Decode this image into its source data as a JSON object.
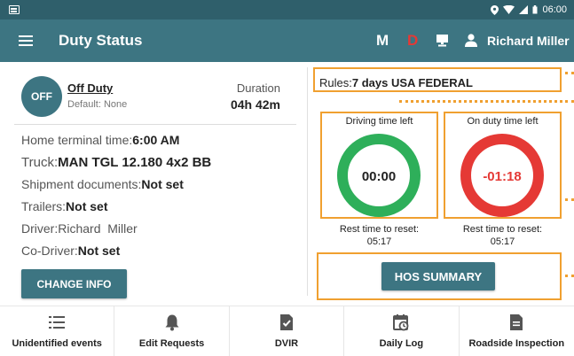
{
  "status_bar": {
    "time": "06:00"
  },
  "app_bar": {
    "title": "Duty Status",
    "badge_m": "M",
    "badge_d": "D",
    "user_name": "Richard Miller"
  },
  "duty": {
    "status_short": "OFF",
    "status_name": "Off Duty",
    "default": "Default: None",
    "duration_label": "Duration",
    "duration_value": "04h 42m"
  },
  "info": {
    "home_terminal_label": "Home terminal time:",
    "home_terminal_value": "6:00 AM",
    "truck_label": "Truck:",
    "truck_value": "MAN TGL 12.180 4x2 BB",
    "shipment_label": "Shipment documents:",
    "shipment_value": "Not set",
    "trailers_label": "Trailers:",
    "trailers_value": "Not set",
    "driver_label": "Driver:",
    "driver_value": "Richard  Miller",
    "codriver_label": "Co-Driver:",
    "codriver_value": "Not set",
    "change_button": "CHANGE INFO"
  },
  "rules": {
    "label": "Rules:",
    "value": "7 days USA FEDERAL"
  },
  "gauges": [
    {
      "label": "Driving time left",
      "value": "00:00",
      "color": "#2eaf5a",
      "rest_label": "Rest time to reset:",
      "rest_value": "05:17"
    },
    {
      "label": "On duty time left",
      "value": "-01:18",
      "color": "#e53935",
      "rest_label": "Rest time to reset:",
      "rest_value": "05:17"
    }
  ],
  "hos_button": "HOS SUMMARY",
  "bottom_nav": [
    {
      "label": "Unidentified events",
      "icon": "list-icon"
    },
    {
      "label": "Edit Requests",
      "icon": "bell-icon"
    },
    {
      "label": "DVIR",
      "icon": "document-check-icon"
    },
    {
      "label": "Daily Log",
      "icon": "calendar-clock-icon"
    },
    {
      "label": "Roadside Inspection",
      "icon": "document-icon"
    }
  ],
  "colors": {
    "status_bar": "#2f5f6b",
    "app_bar": "#3d7582",
    "accent_orange": "#f0a030",
    "danger": "#e53935",
    "ok": "#2eaf5a"
  }
}
